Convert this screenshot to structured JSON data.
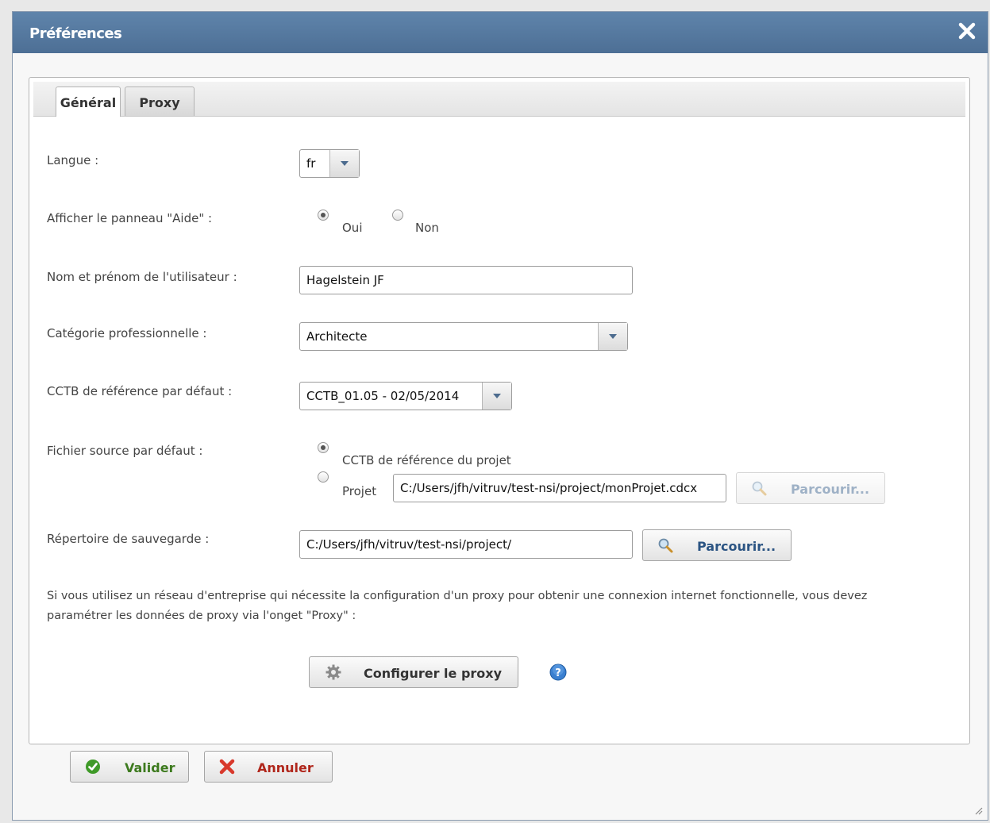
{
  "window": {
    "title": "Préférences"
  },
  "tabs": [
    {
      "label": "Général",
      "active": true
    },
    {
      "label": "Proxy",
      "active": false
    }
  ],
  "general": {
    "langue": {
      "label": "Langue :",
      "value": "fr"
    },
    "aide": {
      "label": "Afficher le panneau \"Aide\" :",
      "options": [
        "Oui",
        "Non"
      ],
      "selected": "Oui"
    },
    "nom": {
      "label": "Nom et prénom de l'utilisateur :",
      "value": "Hagelstein JF"
    },
    "categorie": {
      "label": "Catégorie professionnelle :",
      "value": "Architecte"
    },
    "cctb": {
      "label": "CCTB de référence par défaut :",
      "value": "CCTB_01.05 - 02/05/2014"
    },
    "fichier": {
      "label": "Fichier source par défaut :",
      "option_reference": "CCTB de référence du projet",
      "option_projet": "Projet",
      "selected": "CCTB de référence du projet",
      "projet_path": "C:/Users/jfh/vitruv/test-nsi/project/monProjet.cdcx",
      "browse_label": "Parcourir..."
    },
    "repertoire": {
      "label": "Répertoire de sauvegarde :",
      "value": "C:/Users/jfh/vitruv/test-nsi/project/",
      "browse_label": "Parcourir..."
    },
    "proxy_note_line1": "Si vous utilisez un réseau d'entreprise qui nécessite la configuration d'un proxy pour obtenir une connexion internet fonctionnelle, vous devez",
    "proxy_note_line2": "paramétrer les données de proxy via l'onget \"Proxy\" :",
    "configure_proxy_label": "Configurer le proxy"
  },
  "footer": {
    "validate_label": "Valider",
    "cancel_label": "Annuler"
  },
  "colors": {
    "titlebar": "#5578a0",
    "validate_text": "#3d7a1e",
    "cancel_text": "#b0261b",
    "browse_text": "#2b5483"
  }
}
